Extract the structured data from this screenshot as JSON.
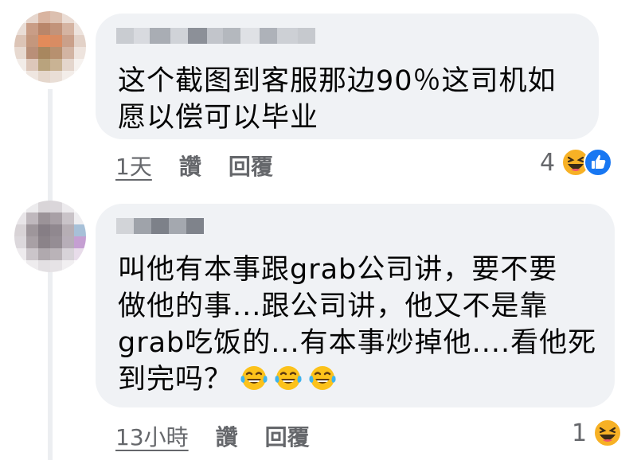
{
  "colors": {
    "bubble": "#f0f2f5",
    "secondary_text": "#65676b",
    "like_blue": "#1877f2",
    "haha_yellow": "#f7b125"
  },
  "comments": [
    {
      "text": "这个截图到客服那边90％这司机如\n愿以偿可以毕业",
      "time": "1天",
      "like_label": "讚",
      "reply_label": "回覆",
      "reaction_count": "4",
      "reaction_icons": [
        "haha-icon",
        "like-icon"
      ]
    },
    {
      "text": "叫他有本事跟grab公司讲，要不要\n做他的事...跟公司讲，他又不是靠\ngrab吃饭的...有本事炒掉他....看他死\n到完吗？",
      "inline_emojis": [
        "tears-of-joy-icon",
        "tears-of-joy-icon",
        "tears-of-joy-icon"
      ],
      "time": "13小時",
      "like_label": "讚",
      "reply_label": "回覆",
      "reaction_count": "1",
      "reaction_icons": [
        "haha-icon"
      ]
    }
  ]
}
